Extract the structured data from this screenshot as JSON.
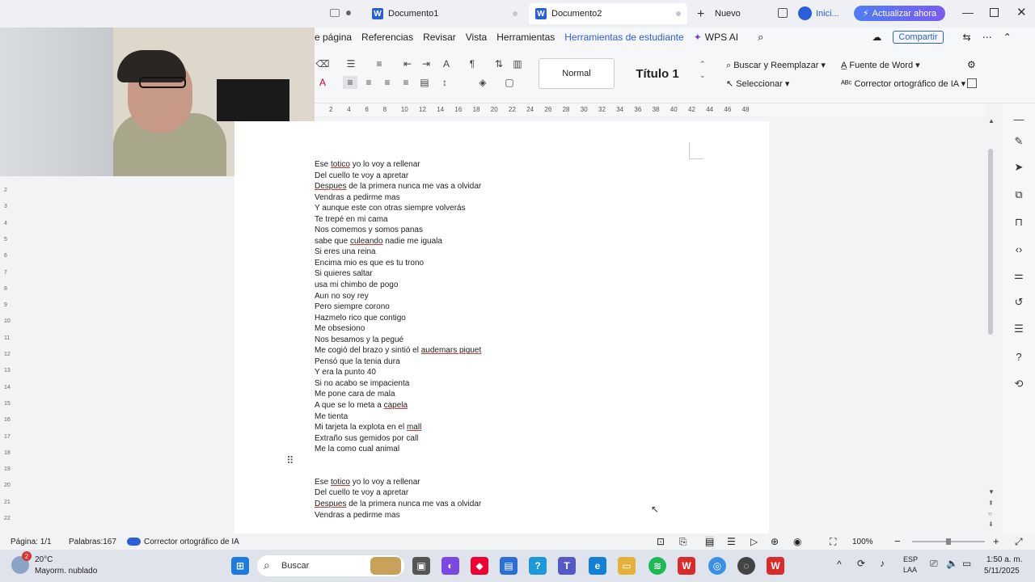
{
  "titlebar": {
    "tabs": [
      {
        "label": "Documento1"
      },
      {
        "label": "Documento2"
      }
    ],
    "new_label": "Nuevo",
    "login_label": "Inici...",
    "upgrade_label": "Actualizar ahora"
  },
  "menubar": {
    "items": [
      "e página",
      "Referencias",
      "Revisar",
      "Vista",
      "Herramientas",
      "Herramientas de estudiante",
      "WPS AI"
    ],
    "share_label": "Compartir"
  },
  "ribbon": {
    "styles": [
      "Normal",
      "Título 1"
    ],
    "find_replace": "Buscar y  Reemplazar",
    "select": "Seleccionar",
    "word_font": "Fuente de Word",
    "ai_spell": "Corrector ortográfico de IA"
  },
  "ruler": {
    "marks": [
      "2",
      "4",
      "6",
      "8",
      "10",
      "12",
      "14",
      "16",
      "18",
      "20",
      "22",
      "24",
      "26",
      "28",
      "30",
      "32",
      "34",
      "36",
      "38",
      "40",
      "42",
      "44",
      "46",
      "48"
    ]
  },
  "vruler": {
    "marks": [
      "2",
      "3",
      "4",
      "5",
      "6",
      "7",
      "8",
      "9",
      "10",
      "11",
      "12",
      "13",
      "14",
      "15",
      "16",
      "17",
      "18",
      "19",
      "20",
      "21",
      "22"
    ]
  },
  "document": {
    "lines": [
      {
        "pre": "Ese ",
        "sq": "totico",
        "post": " yo lo voy a rellenar"
      },
      {
        "pre": "Del cuello te voy a apretar",
        "sq": "",
        "post": ""
      },
      {
        "pre": "",
        "sq": "Despues",
        "post": " de la primera nunca me vas a olvidar"
      },
      {
        "pre": "Vendras a pedirme mas",
        "sq": "",
        "post": ""
      },
      {
        "pre": "Y aunque este con otras siempre volverás",
        "sq": "",
        "post": ""
      },
      {
        "pre": "Te trepé en mi cama",
        "sq": "",
        "post": ""
      },
      {
        "pre": "Nos comemos y somos panas",
        "sq": "",
        "post": ""
      },
      {
        "pre": "sabe que ",
        "sq": "culeando",
        "post": " nadie me iguala"
      },
      {
        "pre": "Si eres una reina",
        "sq": "",
        "post": ""
      },
      {
        "pre": "Encima mio es que es tu trono",
        "sq": "",
        "post": ""
      },
      {
        "pre": "Si quieres saltar",
        "sq": "",
        "post": ""
      },
      {
        "pre": "usa mi chimbo de pogo",
        "sq": "",
        "post": ""
      },
      {
        "pre": "Aun no soy rey",
        "sq": "",
        "post": ""
      },
      {
        "pre": "Pero siempre corono",
        "sq": "",
        "post": ""
      },
      {
        "pre": "Hazmelo rico que contigo",
        "sq": "",
        "post": ""
      },
      {
        "pre": "Me obsesiono",
        "sq": "",
        "post": ""
      },
      {
        "pre": "Nos besamos y la pegué",
        "sq": "",
        "post": ""
      },
      {
        "pre": "Me cogió del brazo y sintió el ",
        "sq": "audemars piguet",
        "post": ""
      },
      {
        "pre": "Pensó que la tenia dura",
        "sq": "",
        "post": ""
      },
      {
        "pre": "Y era la punto 40",
        "sq": "",
        "post": ""
      },
      {
        "pre": "Si no acabo se impacienta",
        "sq": "",
        "post": ""
      },
      {
        "pre": "Me pone cara de mala",
        "sq": "",
        "post": ""
      },
      {
        "pre": "A que se lo meta a ",
        "sq": "capela",
        "post": ""
      },
      {
        "pre": "Me tienta",
        "sq": "",
        "post": ""
      },
      {
        "pre": "Mi tarjeta la explota en el ",
        "sq": "mall",
        "post": ""
      },
      {
        "pre": "Extraño sus gemidos por call",
        "sq": "",
        "post": ""
      },
      {
        "pre": "Me la como cual animal",
        "sq": "",
        "post": ""
      },
      {
        "pre": "",
        "sq": "",
        "post": ""
      },
      {
        "pre": "",
        "sq": "",
        "post": ""
      },
      {
        "pre": "Ese ",
        "sq": "totico",
        "post": " yo lo voy a rellenar"
      },
      {
        "pre": "Del cuello te voy a apretar",
        "sq": "",
        "post": ""
      },
      {
        "pre": "",
        "sq": "Despues",
        "post": " de la primera nunca me vas a olvidar"
      },
      {
        "pre": "Vendras a pedirme mas",
        "sq": "",
        "post": ""
      }
    ]
  },
  "statusbar": {
    "page": "Página: 1/1",
    "words": "Palabras:167",
    "ai_spell": "Corrector ortográfico de IA",
    "zoom": "100%"
  },
  "taskbar": {
    "weather_temp": "20°C",
    "weather_desc": "Mayorm. nublado",
    "weather_badge": "2",
    "search": "Buscar",
    "lang1": "ESP",
    "lang2": "LAA",
    "time": "1:50 a. m.",
    "date": "5/11/2025"
  },
  "colors": {
    "accent": "#2b5fd9",
    "upgrade": "#5b62f0",
    "squiggle": "#d33333"
  }
}
